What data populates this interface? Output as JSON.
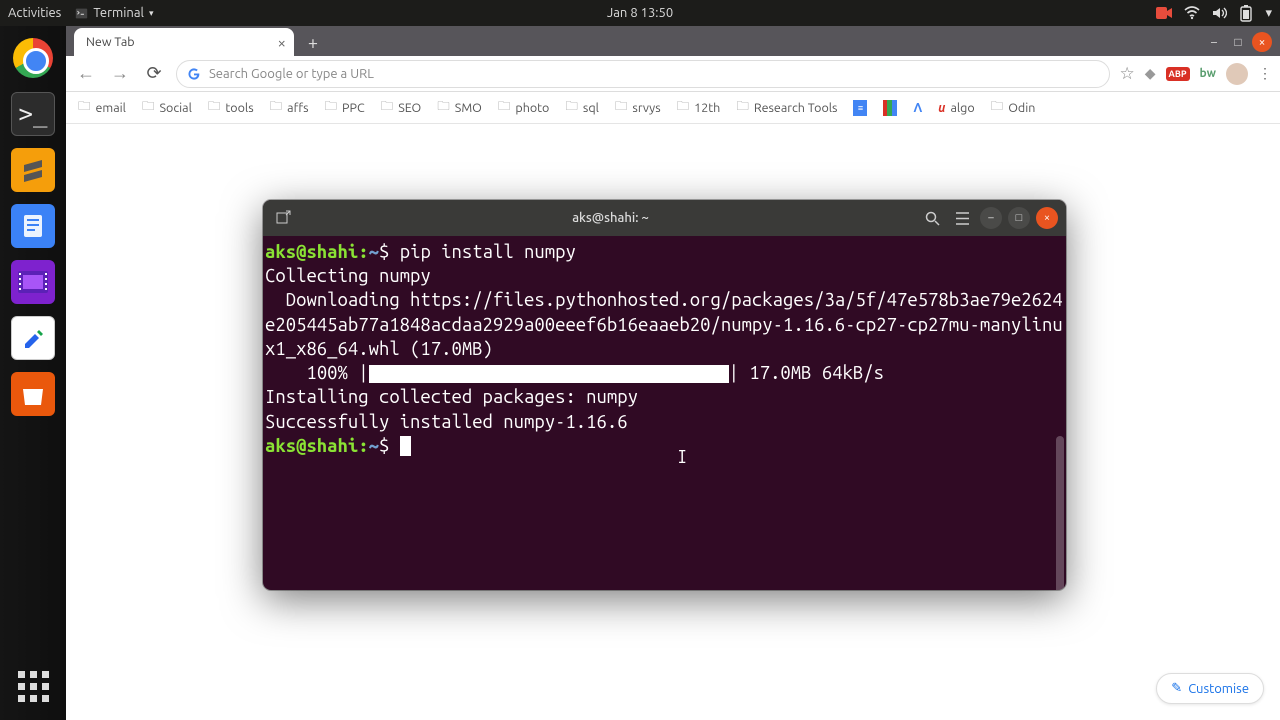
{
  "topbar": {
    "activities": "Activities",
    "terminal_menu": "Terminal",
    "datetime": "Jan 8  13:50"
  },
  "chrome": {
    "tab_title": "New Tab",
    "omnibox_placeholder": "Search Google or type a URL",
    "customise_label": "Customise",
    "bookmarks": [
      {
        "label": "email",
        "icon": "folder"
      },
      {
        "label": "Social",
        "icon": "folder"
      },
      {
        "label": "tools",
        "icon": "folder"
      },
      {
        "label": "affs",
        "icon": "folder"
      },
      {
        "label": "PPC",
        "icon": "folder"
      },
      {
        "label": "SEO",
        "icon": "folder"
      },
      {
        "label": "SMO",
        "icon": "folder"
      },
      {
        "label": "photo",
        "icon": "folder"
      },
      {
        "label": "sql",
        "icon": "folder"
      },
      {
        "label": "srvys",
        "icon": "folder"
      },
      {
        "label": "12th",
        "icon": "folder"
      },
      {
        "label": "Research Tools",
        "icon": "folder"
      },
      {
        "label": "",
        "icon": "docs"
      },
      {
        "label": "",
        "icon": "sheets"
      },
      {
        "label": "",
        "icon": "ads"
      },
      {
        "label": "algo",
        "icon": "u"
      },
      {
        "label": "Odin",
        "icon": "folder"
      }
    ]
  },
  "terminal": {
    "title": "aks@shahi: ~",
    "prompt_user": "aks@shahi",
    "prompt_path": "~",
    "command": "pip install numpy",
    "lines": {
      "collecting": "Collecting numpy",
      "downloading": "  Downloading https://files.pythonhosted.org/packages/3a/5f/47e578b3ae79e2624e205445ab77a1848acdaa2929a00eeef6b16eaaeb20/numpy-1.16.6-cp27-cp27mu-manylinux1_x86_64.whl (17.0MB)",
      "progress_pct": "    100% |",
      "progress_suffix": "| 17.0MB 64kB/s",
      "installing": "Installing collected packages: numpy",
      "success": "Successfully installed numpy-1.16.6"
    }
  }
}
